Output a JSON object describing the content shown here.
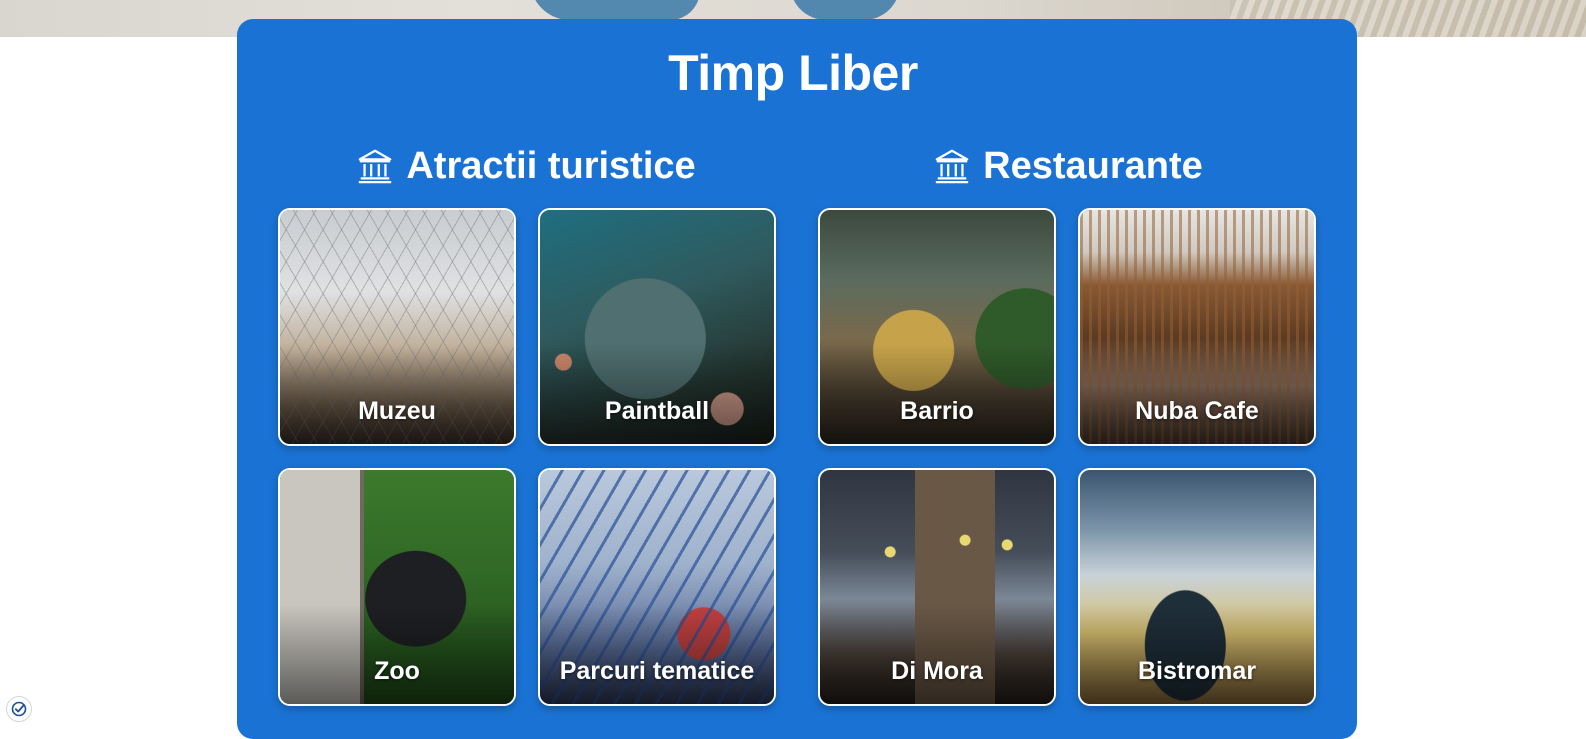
{
  "page": {
    "title": "Timp Liber",
    "colors": {
      "panel": "#1a73d4",
      "text": "#ffffff",
      "card_border": "#ffffff"
    }
  },
  "sections": [
    {
      "title": "Atractii turistice",
      "icon": "museum-icon",
      "cards": [
        {
          "label": "Muzeu",
          "image": "museum-photo"
        },
        {
          "label": "Paintball",
          "image": "paintball-photo"
        },
        {
          "label": "Zoo",
          "image": "bear-photo"
        },
        {
          "label": "Parcuri tematice",
          "image": "rollercoaster-photo"
        }
      ]
    },
    {
      "title": "Restaurante",
      "icon": "museum-icon",
      "cards": [
        {
          "label": "Barrio",
          "image": "restaurant-photo"
        },
        {
          "label": "Nuba Cafe",
          "image": "cafe-bar-photo"
        },
        {
          "label": "Di Mora",
          "image": "restaurant-interior-photo"
        },
        {
          "label": "Bistromar",
          "image": "bistro-kitchen-photo"
        }
      ]
    }
  ],
  "badge": {
    "icon": "verified-check-icon"
  }
}
